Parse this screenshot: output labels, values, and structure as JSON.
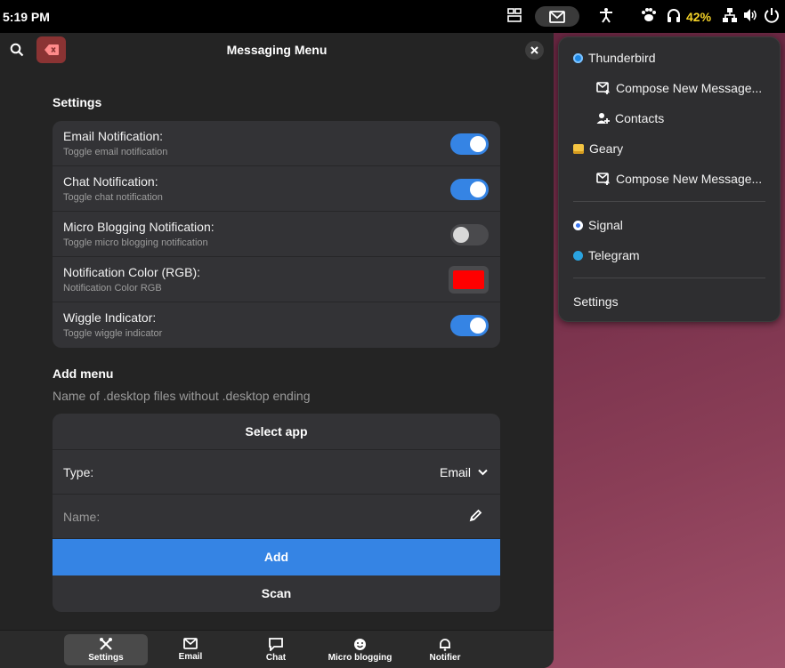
{
  "topbar": {
    "time": "5:19 PM",
    "battery": "42%",
    "icons": [
      "workspace-icon",
      "mail-icon",
      "accessibility-icon",
      "paw-icon",
      "headphones-icon",
      "network-icon",
      "volume-icon",
      "power-icon"
    ]
  },
  "window": {
    "title": "Messaging Menu",
    "settings_title": "Settings",
    "settings": [
      {
        "title": "Email Notification:",
        "subtitle": "Toggle email notification",
        "on": true
      },
      {
        "title": "Chat Notification:",
        "subtitle": "Toggle chat notification",
        "on": true
      },
      {
        "title": "Micro Blogging Notification:",
        "subtitle": "Toggle micro blogging notification",
        "on": false
      },
      {
        "title": "Notification Color (RGB):",
        "subtitle": "Notification Color RGB",
        "color": "#ff0000"
      },
      {
        "title": "Wiggle Indicator:",
        "subtitle": "Toggle wiggle indicator",
        "on": true
      }
    ],
    "add_menu": {
      "title": "Add menu",
      "description": "Name of .desktop files without .desktop ending",
      "select_app": "Select app",
      "type_label": "Type:",
      "type_value": "Email",
      "name_placeholder": "Name:",
      "add_label": "Add",
      "scan_label": "Scan"
    },
    "tabs": [
      {
        "label": "Settings",
        "active": true
      },
      {
        "label": "Email",
        "active": false
      },
      {
        "label": "Chat",
        "active": false
      },
      {
        "label": "Micro blogging",
        "active": false
      },
      {
        "label": "Notifier",
        "active": false
      }
    ]
  },
  "menu": {
    "items": [
      {
        "label": "Thunderbird",
        "icon": "thunderbird-icon",
        "color": "#1e88e5"
      },
      {
        "label": "Compose New Message...",
        "icon": "compose-icon"
      },
      {
        "label": "Contacts",
        "icon": "contacts-icon"
      },
      {
        "label": "Geary",
        "icon": "geary-icon",
        "color": "#f5c542"
      },
      {
        "label": "Compose New Message...",
        "icon": "compose-icon"
      },
      {
        "label": "Signal",
        "icon": "signal-icon",
        "color": "#3a76f0"
      },
      {
        "label": "Telegram",
        "icon": "telegram-icon",
        "color": "#2aa3e0"
      },
      {
        "label": "Settings"
      }
    ]
  },
  "colors": {
    "accent": "#3584e4",
    "window_bg": "#242424",
    "card_bg": "#333336",
    "clear_button": "#8a3333",
    "battery": "#f5d328"
  }
}
